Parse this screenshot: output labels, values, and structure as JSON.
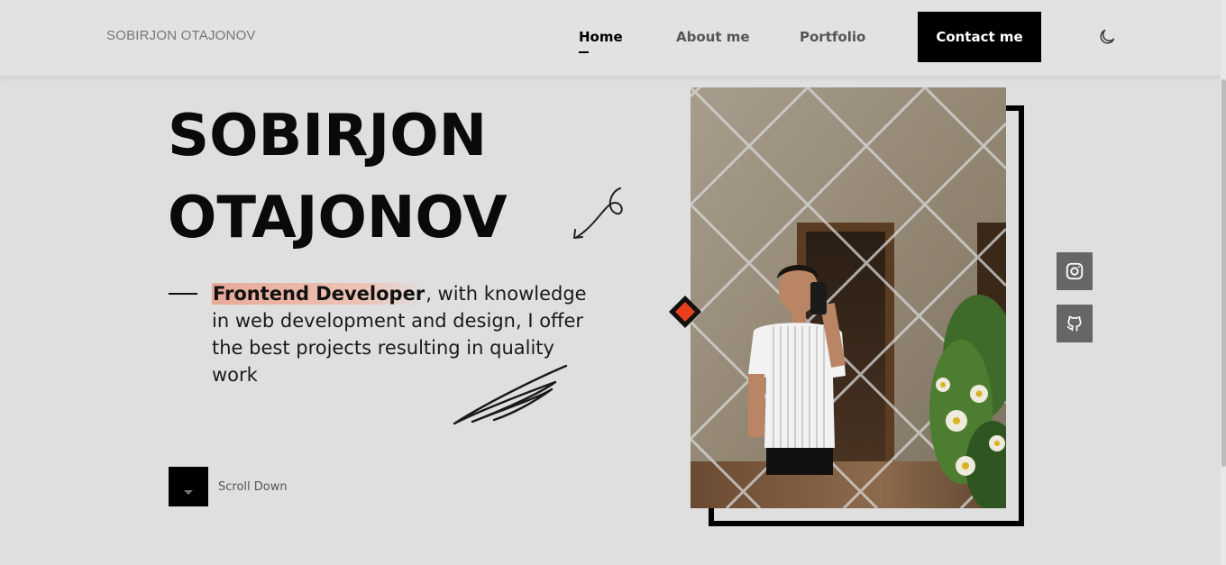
{
  "header": {
    "brand": "SOBIRJON OTAJONOV",
    "nav": [
      {
        "label": "Home",
        "active": true
      },
      {
        "label": "About me",
        "active": false
      },
      {
        "label": "Portfolio",
        "active": false
      }
    ],
    "contact_label": "Contact me",
    "theme_icon": "moon-icon"
  },
  "hero": {
    "title_line1": "SOBIRJON",
    "title_line2": "OTAJONOV",
    "role_highlight": "Frontend Developer",
    "description_rest": ", with knowledge in web development and design, I offer the best projects resulting in quality work",
    "scroll_label": "Scroll Down"
  },
  "social": [
    {
      "icon": "instagram-icon"
    },
    {
      "icon": "github-icon"
    }
  ],
  "colors": {
    "background": "#dfdfdf",
    "accent_orange": "#e8401c",
    "highlight": "#e7a897",
    "black": "#000000"
  }
}
